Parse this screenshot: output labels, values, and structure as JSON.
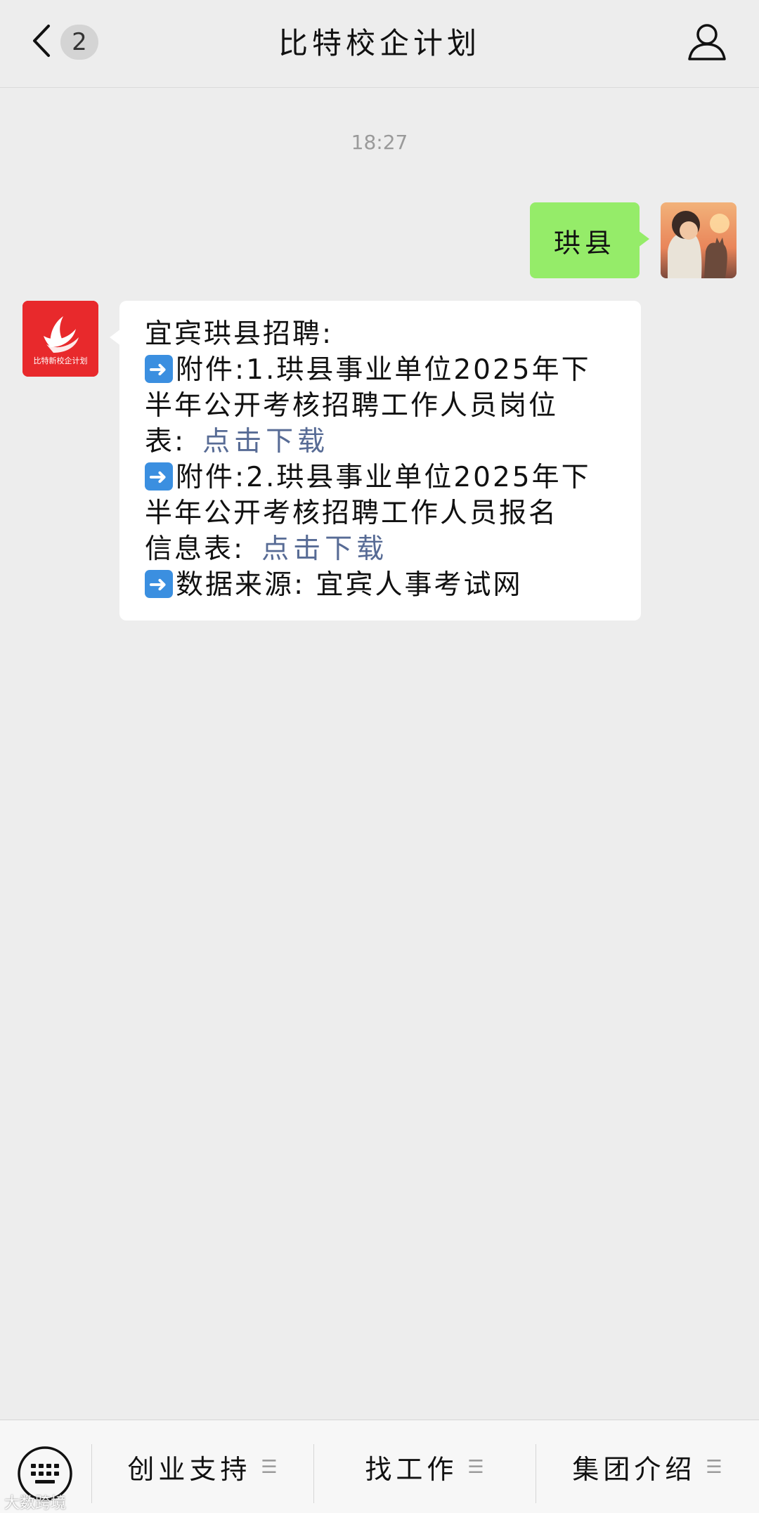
{
  "header": {
    "title": "比特校企计划",
    "unread_count": "2"
  },
  "chat": {
    "timestamp": "18:27",
    "outgoing_message": "珙县",
    "incoming": {
      "line1": "宜宾珙县招聘:",
      "line2": "附件:1.珙县事业单位2025年下",
      "line3": "半年公开考核招聘工作人员岗位",
      "line4_prefix": "表:",
      "line4_link": "点击下载",
      "line5": "附件:2.珙县事业单位2025年下",
      "line6": "半年公开考核招聘工作人员报名",
      "line7_prefix": "信息表:",
      "line7_link": "点击下载",
      "line8": "数据来源: 宜宾人事考试网"
    },
    "bot_logo_text": "比特新校企计划"
  },
  "bottom_menu": {
    "items": [
      {
        "label": "创业支持"
      },
      {
        "label": "找工作"
      },
      {
        "label": "集团介绍"
      }
    ]
  },
  "watermark": "大数跨境",
  "colors": {
    "outgoing_bubble": "#95ec69",
    "link": "#576b95",
    "bot_logo": "#e8292c",
    "background": "#ededed"
  }
}
